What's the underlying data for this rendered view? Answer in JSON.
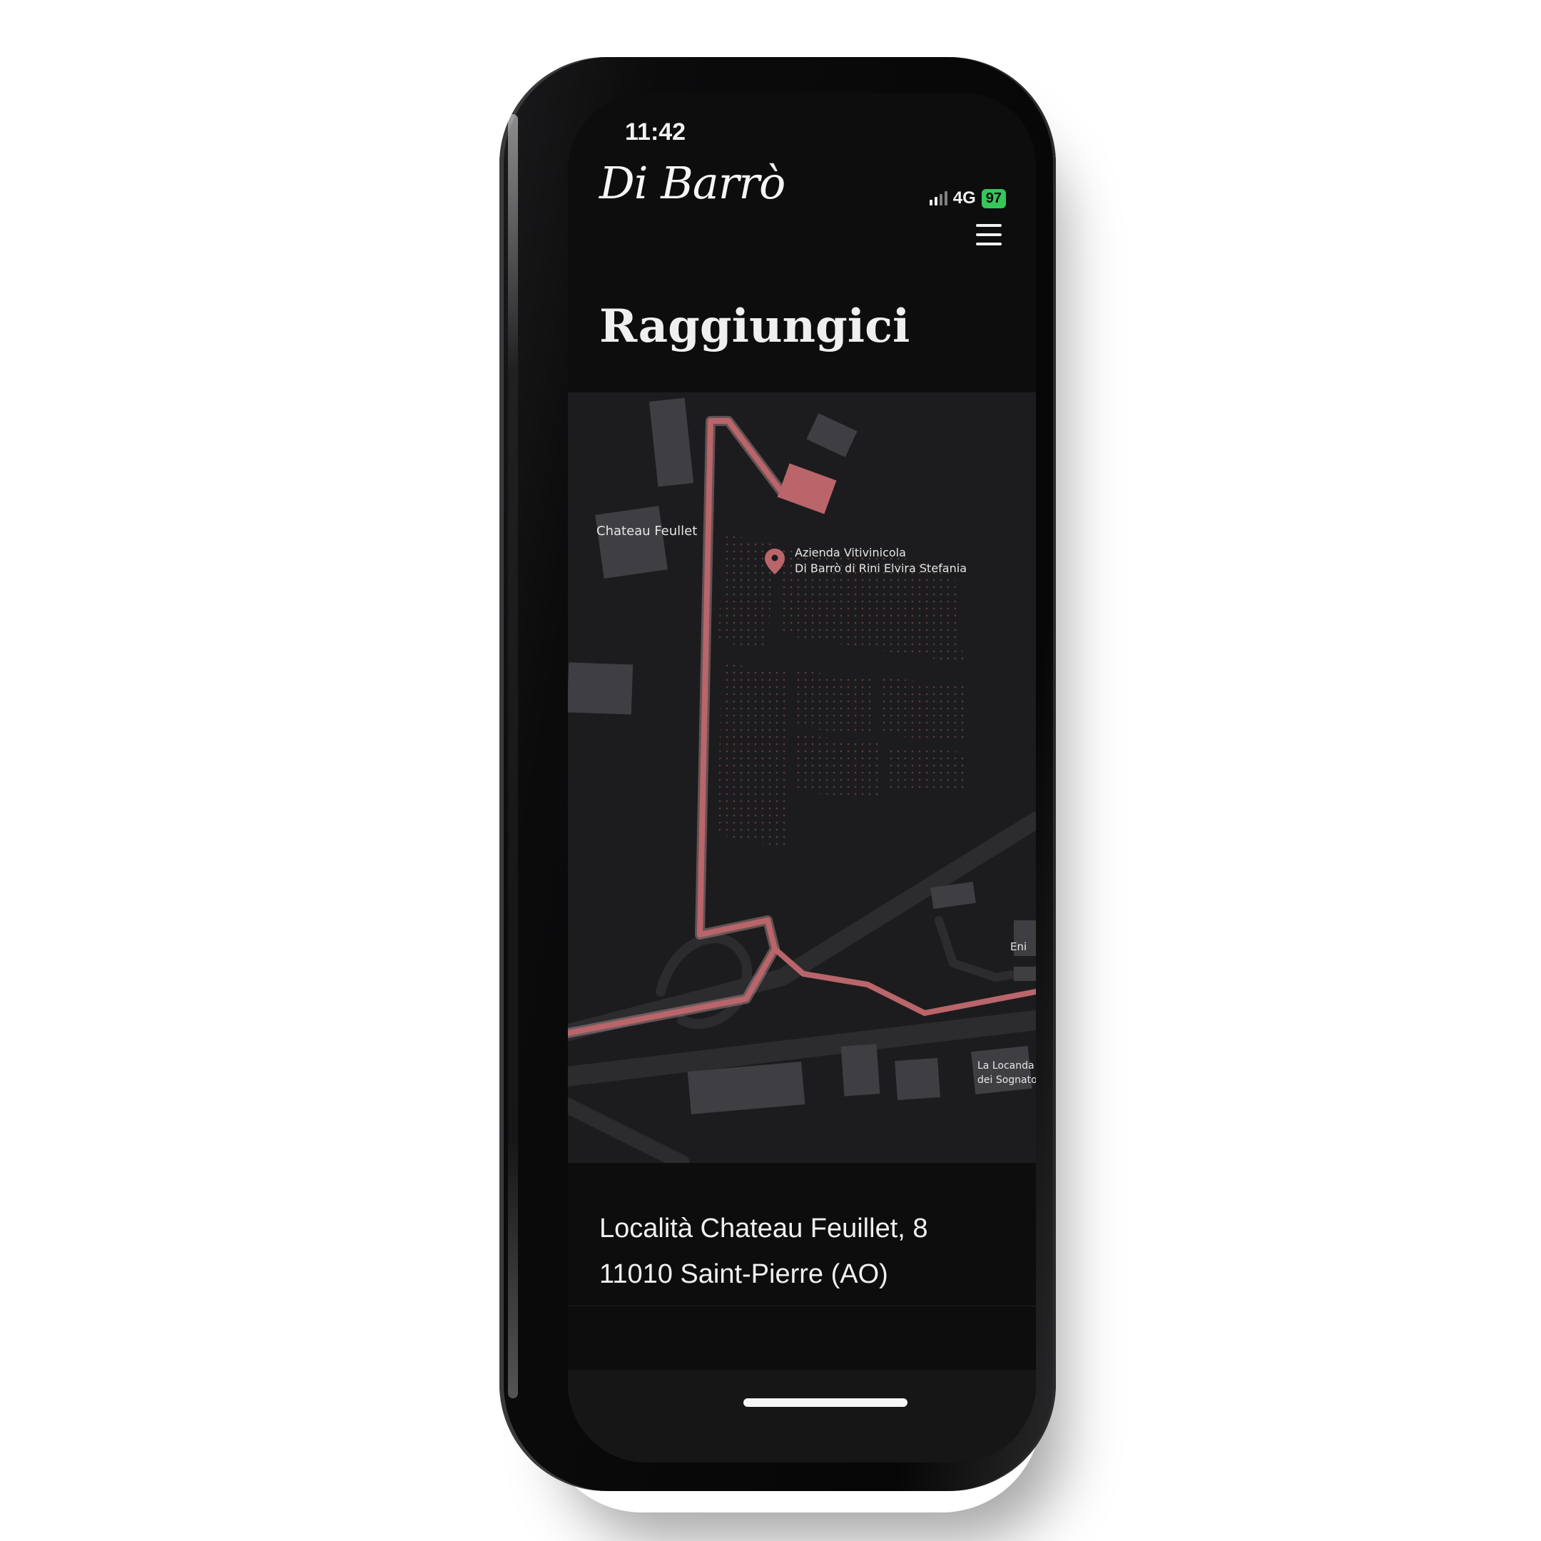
{
  "status_bar": {
    "time": "11:42",
    "network": "4G",
    "battery": "97"
  },
  "header": {
    "logo_text": "Di Barrò",
    "menu_icon": "hamburger-menu-icon"
  },
  "page": {
    "title": "Raggiungici"
  },
  "map": {
    "labels": {
      "chateau": "Chateau Feullet",
      "winery_line1": "Azienda Vitivinicola",
      "winery_line2": "Di Barrò di Rini Elvira Stefania",
      "eni": "Eni",
      "locanda_line1": "La Locanda",
      "locanda_line2": "dei Sognatori"
    },
    "pin_icon": "map-pin-icon",
    "colors": {
      "background": "#1c1c1e",
      "building": "#3f3f43",
      "road": "#2c2c2f",
      "route": "#b9656a",
      "destination": "#b9656a"
    }
  },
  "address": {
    "line1": "Località Chateau Feuillet, 8",
    "line2": "11010 Saint-Pierre (AO)"
  },
  "colors": {
    "screen_bg": "#0d0d0e",
    "text": "#f0f0f0",
    "battery": "#35c759"
  }
}
